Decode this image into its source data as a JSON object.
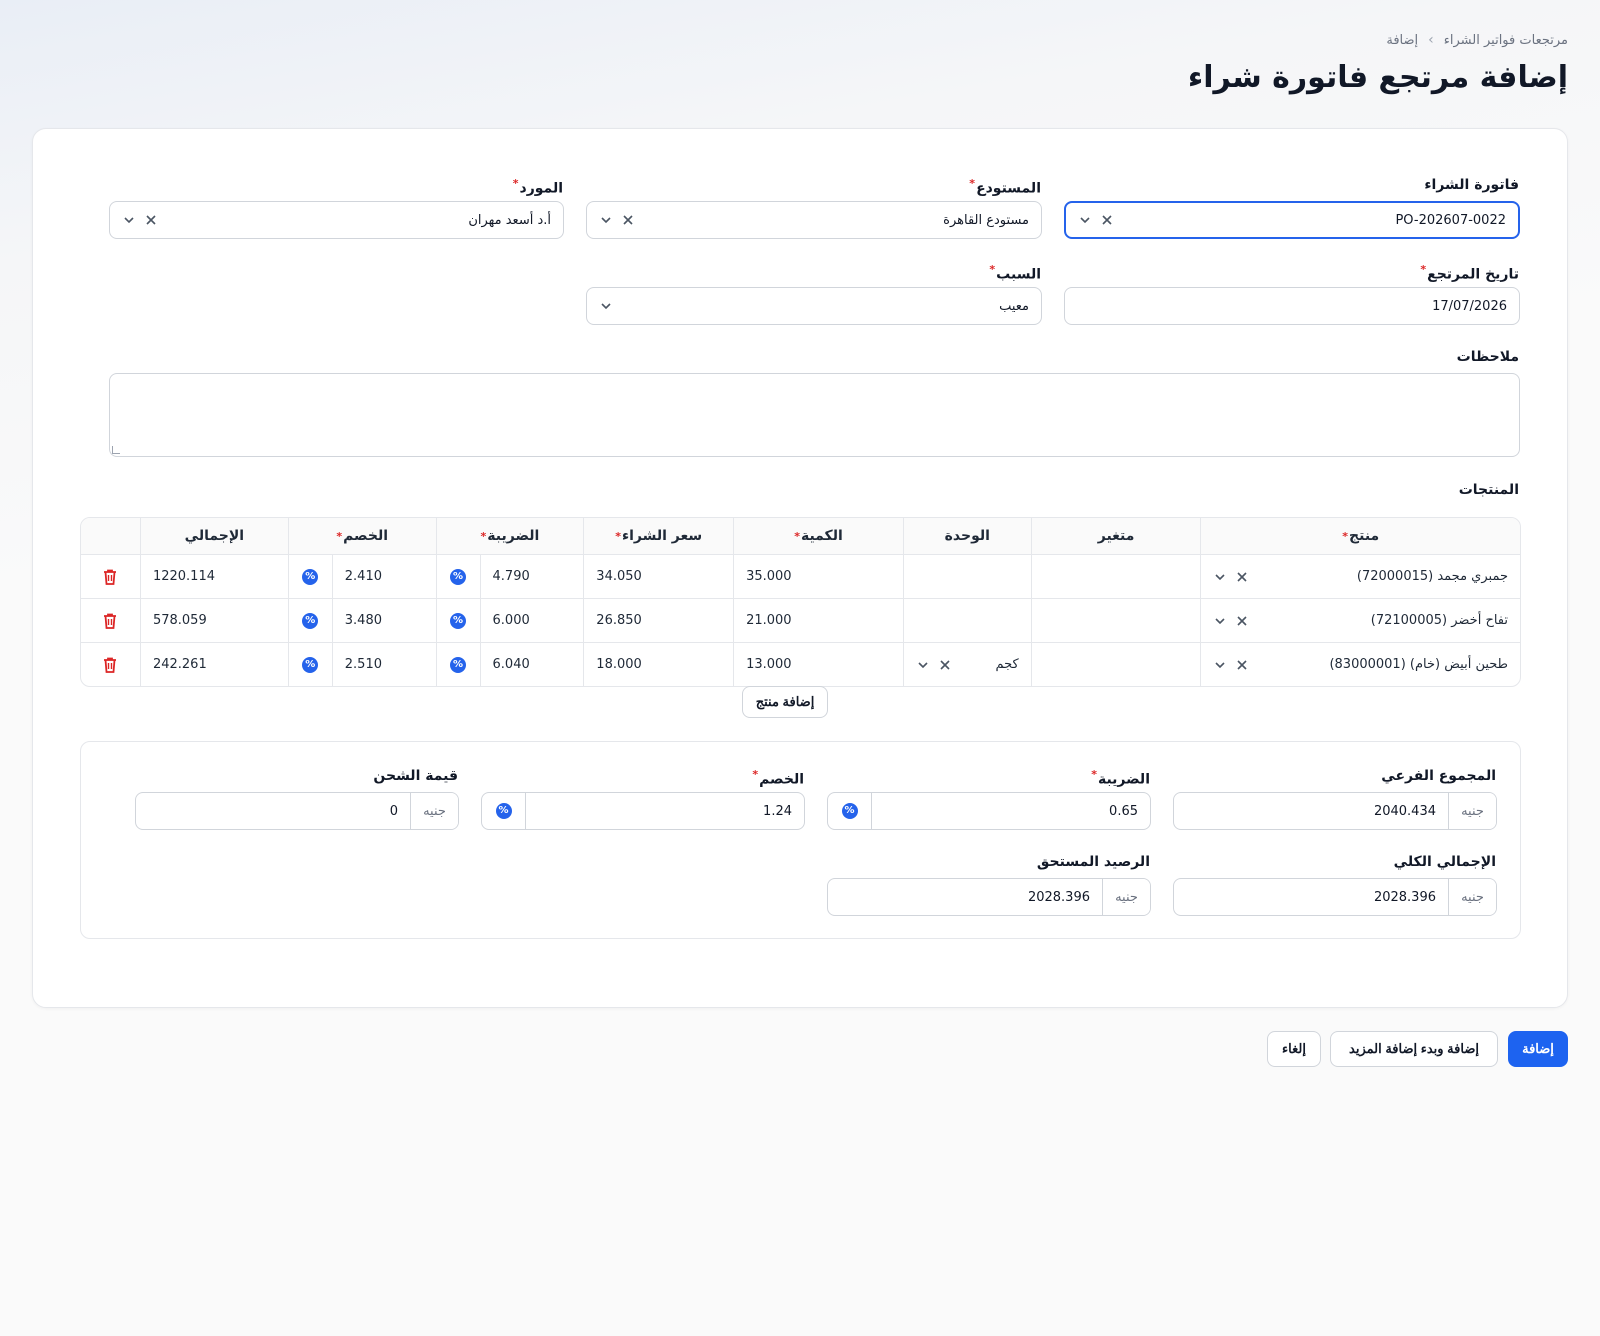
{
  "breadcrumb": {
    "parent": "مرتجعات فواتير الشراء",
    "separator": "›",
    "current": "إضافة"
  },
  "title": "إضافة مرتجع فاتورة شراء",
  "form": {
    "invoice": {
      "label": "فاتورة الشراء",
      "value": "PO-202607-0022"
    },
    "warehouse": {
      "label": "المستودع",
      "value": "مستودع القاهرة"
    },
    "supplier": {
      "label": "المورد",
      "value": "أ.د أسعد مهران"
    },
    "return_date": {
      "label": "تاريخ المرتجع",
      "value": "17/07/2026"
    },
    "reason": {
      "label": "السبب",
      "value": "معيب"
    },
    "notes": {
      "label": "ملاحظات",
      "value": ""
    }
  },
  "products": {
    "label": "المنتجات",
    "headers": {
      "product": "منتج",
      "variant": "متغير",
      "unit": "الوحدة",
      "quantity": "الكمية",
      "price": "سعر الشراء",
      "tax": "الضريبة",
      "discount": "الخصم",
      "total": "الإجمالي"
    },
    "rows": [
      {
        "product": "جمبري مجمد (72000015)",
        "variant": "",
        "unit": "",
        "quantity": "35.000",
        "price": "34.050",
        "tax": "4.790",
        "discount": "2.410",
        "total": "1220.114"
      },
      {
        "product": "تفاح أخضر (72100005)",
        "variant": "",
        "unit": "",
        "quantity": "21.000",
        "price": "26.850",
        "tax": "6.000",
        "discount": "3.480",
        "total": "578.059"
      },
      {
        "product": "طحين أبيض (خام) (83000001)",
        "variant": "",
        "unit": "كجم",
        "quantity": "13.000",
        "price": "18.000",
        "tax": "6.040",
        "discount": "2.510",
        "total": "242.261"
      }
    ],
    "add_button": "إضافة منتج"
  },
  "summary": {
    "currency": "جنيه",
    "subtotal": {
      "label": "المجموع الفرعي",
      "value": "2040.434"
    },
    "tax": {
      "label": "الضريبة",
      "value": "0.65"
    },
    "discount": {
      "label": "الخصم",
      "value": "1.24"
    },
    "shipping": {
      "label": "قيمة الشحن",
      "value": "0"
    },
    "grand_total": {
      "label": "الإجمالي الكلي",
      "value": "2028.396"
    },
    "balance_due": {
      "label": "الرصيد المستحق",
      "value": "2028.396"
    }
  },
  "actions": {
    "add": "إضافة",
    "add_and_more": "إضافة وبدء إضافة المزيد",
    "cancel": "إلغاء"
  },
  "icons": {
    "clear": "close-icon",
    "dropdown": "chevron-down-icon",
    "percent": "percent-icon",
    "delete": "trash-icon"
  },
  "colors": {
    "accent": "#1d63f0",
    "danger": "#dc2626",
    "required": "#dc2626"
  }
}
